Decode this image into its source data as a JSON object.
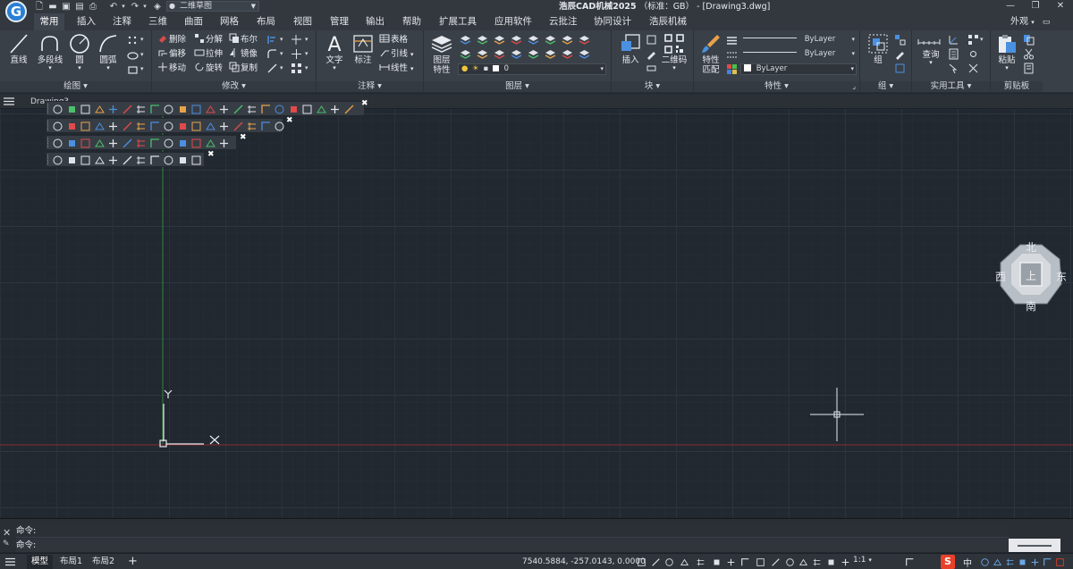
{
  "titlebar": {
    "app_name": "浩辰CAD机械2025",
    "standard": "（标准：GB）",
    "document": "- [Drawing3.dwg]",
    "workspace": "二维草图",
    "logo_letter": "G"
  },
  "ribbon_tabs": [
    "常用",
    "插入",
    "注释",
    "三维",
    "曲面",
    "网格",
    "布局",
    "视图",
    "管理",
    "输出",
    "帮助",
    "扩展工具",
    "应用软件",
    "云批注",
    "协同设计",
    "浩辰机械"
  ],
  "appearance_label": "外观",
  "groups": {
    "draw": {
      "label": "绘图",
      "line": "直线",
      "polyline": "多段线",
      "circle": "圆",
      "arc": "圆弧"
    },
    "modify": {
      "label": "修改",
      "erase": "删除",
      "explode": "分解",
      "boolean": "布尔",
      "offset": "偏移",
      "stretch": "拉伸",
      "mirror": "镜像",
      "move": "移动",
      "rotate": "旋转",
      "copy": "复制"
    },
    "annotation": {
      "label": "注释",
      "text": "文字",
      "dimension": "标注",
      "table": "表格",
      "leader": "引线",
      "linear": "线性"
    },
    "layers": {
      "label": "图层",
      "layer_props": "图层\n特性",
      "layer_props_l1": "图层",
      "layer_props_l2": "特性",
      "current_layer": "0"
    },
    "block": {
      "label": "块",
      "insert": "插入",
      "qrcode": "二维码"
    },
    "properties": {
      "label": "特性",
      "match_l1": "特性",
      "match_l2": "匹配",
      "linetype": "ByLayer",
      "lineweight": "ByLayer",
      "color": "ByLayer"
    },
    "group": {
      "label": "组",
      "group": "组"
    },
    "utilities": {
      "label": "实用工具",
      "query": "查询"
    },
    "clipboard": {
      "label": "剪贴板",
      "paste": "粘贴"
    }
  },
  "doc_tab": "Drawing3",
  "viewcube": {
    "north": "北",
    "south": "南",
    "east": "东",
    "west": "西",
    "top": "上"
  },
  "ucs": {
    "x_label": "X",
    "y_label": "Y"
  },
  "command": {
    "line1": "命令:",
    "line2": "命令:"
  },
  "layout_tabs": [
    "模型",
    "布局1",
    "布局2"
  ],
  "add_layout": "+",
  "coordinates": "7540.5884, -257.0143, 0.0000",
  "status": {
    "scale": "1:1",
    "ime_lang": "中"
  },
  "colors": {
    "canvas": "#212830",
    "ribbon": "#3a4048",
    "accent_blue": "#2a7fd4",
    "y_axis": "#2f8a3a",
    "x_axis": "#8a2a30"
  }
}
